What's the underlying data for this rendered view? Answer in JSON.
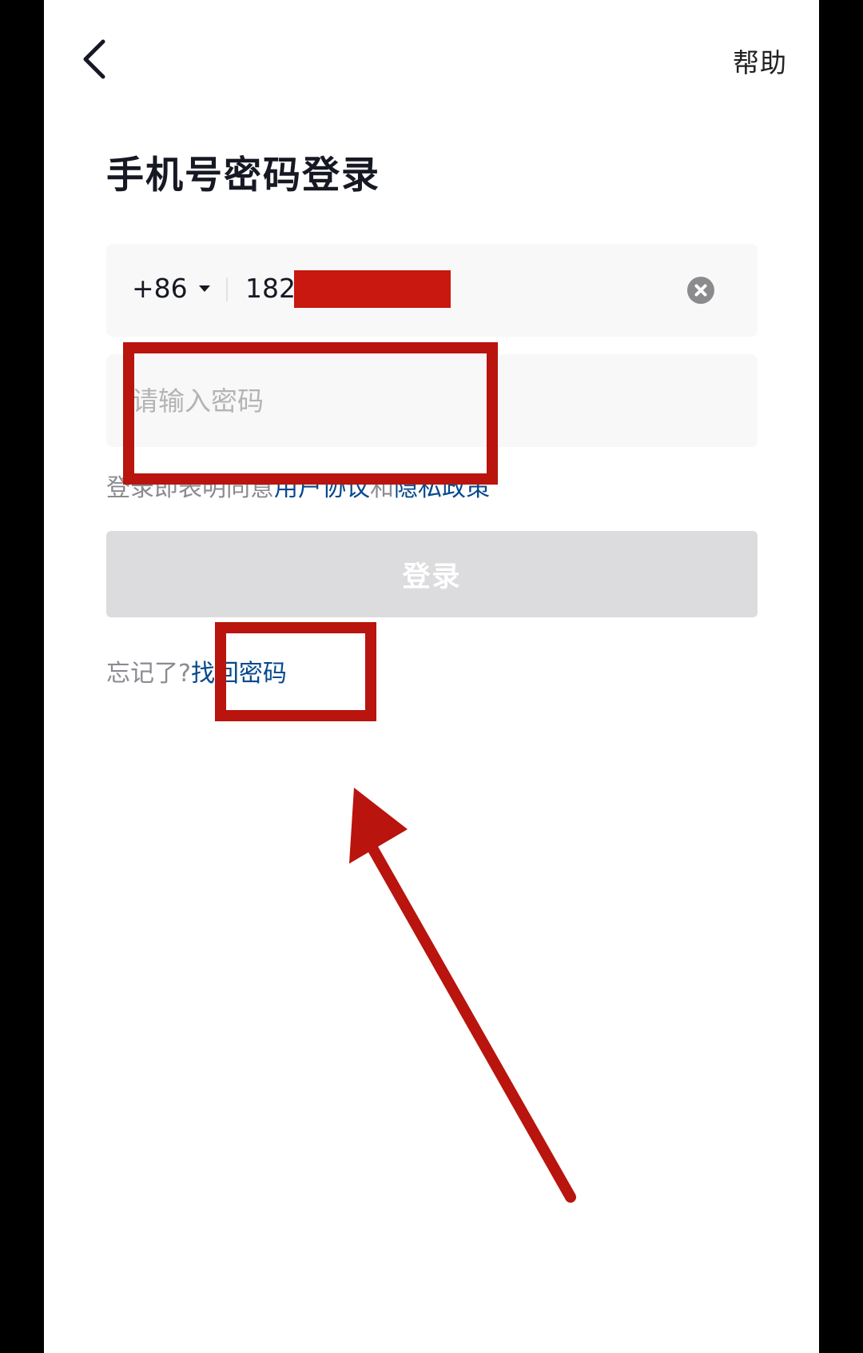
{
  "header": {
    "back_icon": "chevron-left-icon",
    "help_label": "帮助"
  },
  "page": {
    "title": "手机号密码登录"
  },
  "phone_field": {
    "country_code": "+86",
    "number_visible": "182",
    "clear_icon": "close-circle-icon"
  },
  "password_field": {
    "value": "",
    "placeholder": "请输入密码"
  },
  "agreement": {
    "prefix": "登录即表明同意",
    "user_agreement": "用户协议",
    "conjunction": "和",
    "privacy_policy": "隐私政策"
  },
  "login": {
    "label": "登录"
  },
  "forgot": {
    "prefix": "忘记了?",
    "link": "找回密码"
  },
  "colors": {
    "annotation": "#b9140d",
    "link": "#04498d",
    "button_disabled": "#dcdcde"
  }
}
